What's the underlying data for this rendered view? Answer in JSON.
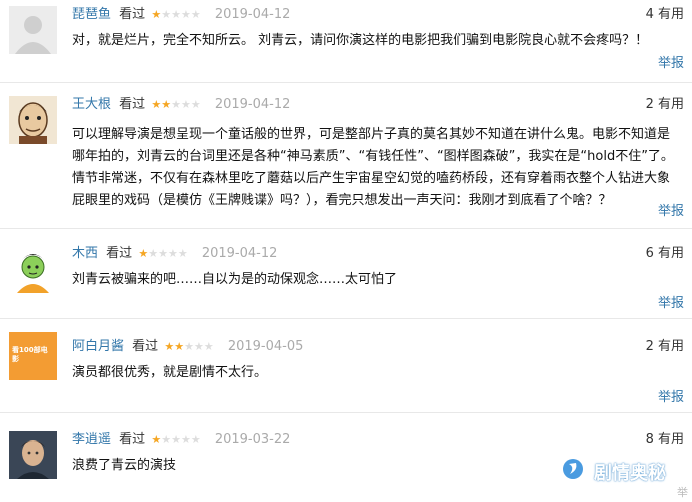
{
  "reviews": [
    {
      "user": "琵琶鱼",
      "seen": "看过",
      "rating": 1,
      "date": "2019-04-12",
      "useful_count": "4",
      "useful_label": "有用",
      "text": "对，就是烂片，完全不知所云。 刘青云，请问你演这样的电影把我们骗到电影院良心就不会疼吗？！",
      "report": "举报"
    },
    {
      "user": "王大根",
      "seen": "看过",
      "rating": 2,
      "date": "2019-04-12",
      "useful_count": "2",
      "useful_label": "有用",
      "text": "可以理解导演是想呈现一个童话般的世界，可是整部片子真的莫名其妙不知道在讲什么鬼。电影不知道是哪年拍的，刘青云的台词里还是各种“神马素质”、“有钱任性”、“图样图森破”，我实在是“hold不住”了。情节非常迷，不仅有在森林里吃了蘑菇以后产生宇宙星空幻觉的嗑药桥段，还有穿着雨衣整个人钻进大象屁眼里的戏码（是模仿《王牌贱谍》吗？），看完只想发出一声天问：我刚才到底看了个啥？？",
      "report": "举报"
    },
    {
      "user": "木西",
      "seen": "看过",
      "rating": 1,
      "date": "2019-04-12",
      "useful_count": "6",
      "useful_label": "有用",
      "text": "刘青云被骗来的吧……自以为是的动保观念……太可怕了",
      "report": "举报"
    },
    {
      "user": "阿白月酱",
      "seen": "看过",
      "rating": 2,
      "date": "2019-04-05",
      "useful_count": "2",
      "useful_label": "有用",
      "text": "演员都很优秀，就是剧情不太行。",
      "report": "举报"
    },
    {
      "user": "李逍遥",
      "seen": "看过",
      "rating": 1,
      "date": "2019-03-22",
      "useful_count": "8",
      "useful_label": "有用",
      "text": "浪费了青云的演技",
      "report": "举报"
    }
  ],
  "avatar4_text": "看100部电影",
  "watermark": "剧情奥秘",
  "corner_text": "举"
}
